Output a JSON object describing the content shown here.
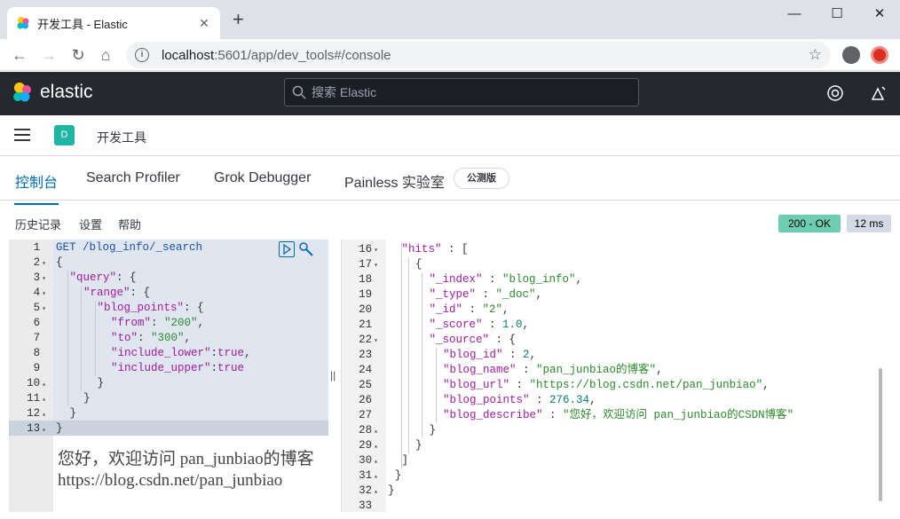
{
  "browser": {
    "tab_title": "开发工具 - Elastic",
    "url_host": "localhost",
    "url_rest": ":5601/app/dev_tools#/console"
  },
  "header": {
    "brand": "elastic",
    "search_placeholder": "搜索 Elastic"
  },
  "breadcrumb": {
    "space_initial": "D",
    "page": "开发工具"
  },
  "tabs": [
    {
      "label": "控制台",
      "active": true
    },
    {
      "label": "Search Profiler",
      "active": false
    },
    {
      "label": "Grok Debugger",
      "active": false
    },
    {
      "label": "Painless 实验室",
      "active": false
    }
  ],
  "beta_badge": "公测版",
  "submenu": {
    "history": "历史记录",
    "settings": "设置",
    "help": "帮助"
  },
  "status": {
    "code": "200 - OK",
    "time": "12 ms"
  },
  "request": {
    "method": "GET",
    "path": "/blog_info/_search",
    "field": "blog_points",
    "from": "200",
    "to": "300",
    "include_lower": "true",
    "include_upper": "true"
  },
  "response": {
    "index": "blog_info",
    "type": "_doc",
    "id": "2",
    "score": "1.0",
    "blog_id": "2",
    "blog_name": "pan_junbiao的博客",
    "blog_url": "https://blog.csdn.net/pan_junbiao",
    "blog_points": "276.34",
    "blog_describe": "您好，欢迎访问 pan_junbiao的CSDN博客"
  },
  "watermark": {
    "line1": "您好，欢迎访问 pan_junbiao的博客",
    "line2": "https://blog.csdn.net/pan_junbiao"
  }
}
